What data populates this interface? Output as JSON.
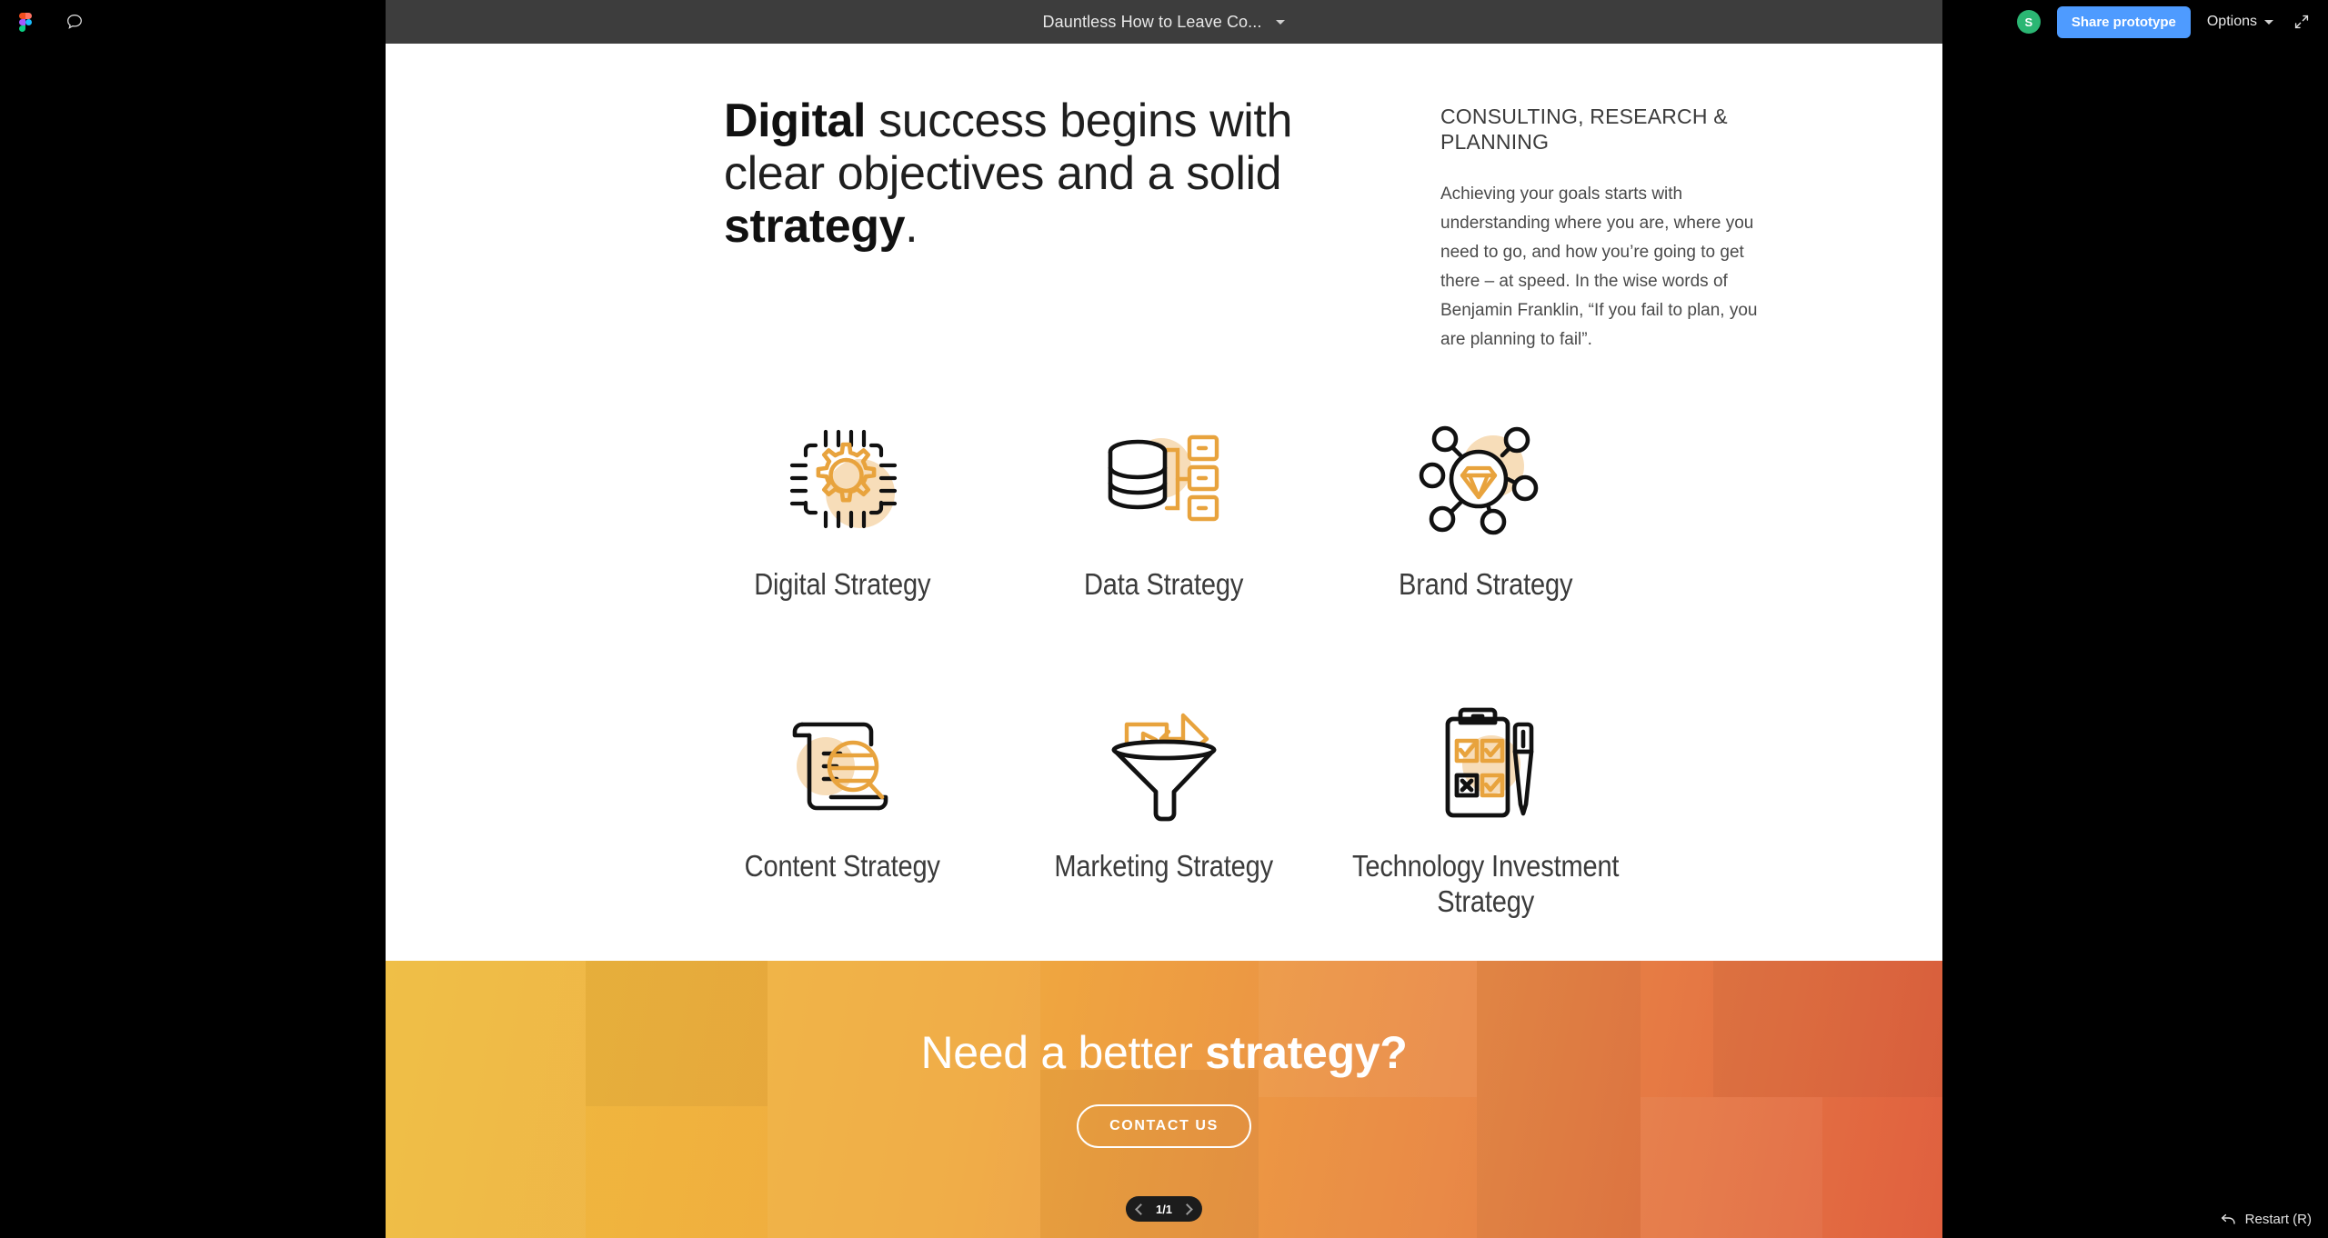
{
  "topbar": {
    "figma_logo": "figma-logo",
    "comment_icon": "comment-icon",
    "frame_title": "Dauntless How to Leave Co...",
    "avatar_initial": "S",
    "share_label": "Share prototype",
    "options_label": "Options",
    "fullscreen_icon": "fullscreen-icon",
    "bar_color": "#3d3d3d",
    "share_color": "#4e9bff",
    "avatar_color": "#2bb673"
  },
  "hero": {
    "headline_part1": "Digital",
    "headline_part2": " success begins with clear objectives and a solid ",
    "headline_part3": "strategy",
    "headline_part4": ".",
    "eyebrow": "CONSULTING, RESEARCH & PLANNING",
    "body": "Achieving your goals starts with understanding where you are, where you need to go, and how you’re going to get there – at speed. In the wise words of Benjamin Franklin, “If you fail to plan, you are planning to fail”."
  },
  "grid": {
    "items": [
      {
        "label": "Digital Strategy",
        "icon": "chip-gear-icon"
      },
      {
        "label": "Data Strategy",
        "icon": "database-nodes-icon"
      },
      {
        "label": "Brand Strategy",
        "icon": "network-diamond-icon"
      },
      {
        "label": "Content Strategy",
        "icon": "scroll-magnifier-icon"
      },
      {
        "label": "Marketing Strategy",
        "icon": "funnel-media-icon"
      },
      {
        "label": "Technology Investment Strategy",
        "icon": "clipboard-pen-icon"
      }
    ]
  },
  "cta": {
    "title_part1": "Need a better ",
    "title_part2": "strategy?",
    "button_label": "CONTACT US",
    "gradient_start": "#efbc3e",
    "gradient_end": "#e0603f"
  },
  "pager": {
    "prev_icon": "chevron-left-icon",
    "page_text": "1/1",
    "next_icon": "chevron-right-icon"
  },
  "footer": {
    "restart_icon": "restart-arrow-icon",
    "restart_label": "Restart (R)"
  },
  "palette": {
    "orange": "#e8a33d",
    "light_orange": "#f7ddb9",
    "ink": "#111111"
  }
}
